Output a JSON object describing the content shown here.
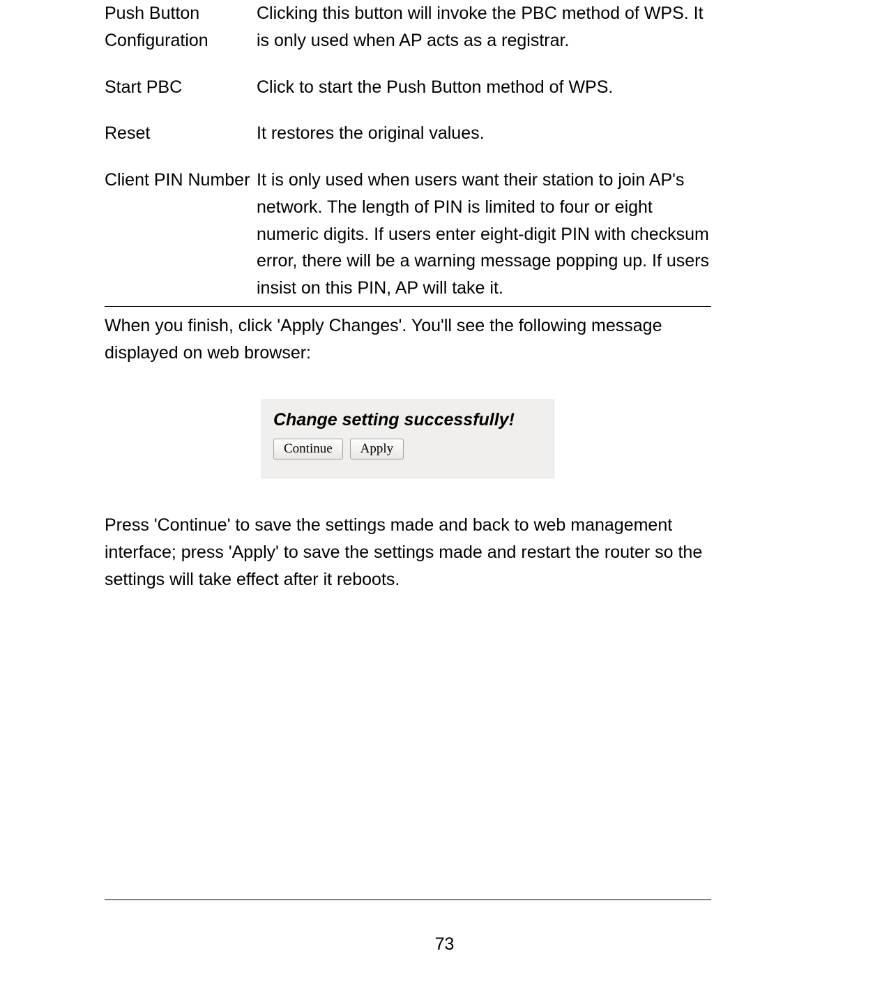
{
  "defs": [
    {
      "term": "Push Button Configuration",
      "desc": "Clicking this button will invoke the PBC method of WPS. It is only used when AP acts as a registrar."
    },
    {
      "term": "Start PBC",
      "desc": "Click to start the Push Button method of WPS."
    },
    {
      "term": "Reset",
      "desc": "It restores the original values."
    },
    {
      "term": "Client PIN Number",
      "desc": "It is only used when users want their station to join AP's network. The length of PIN is limited to four or eight numeric digits. If users enter eight-digit PIN with checksum error, there will be a warning message popping up. If users insist on this PIN, AP will take it."
    }
  ],
  "para_after_table": "When you finish, click 'Apply Changes'. You'll see the following message displayed on web browser:",
  "dialog": {
    "title": "Change setting successfully!",
    "continue_label": "Continue",
    "apply_label": "Apply"
  },
  "para_after_dialog": "Press 'Continue' to save the settings made and back to web management interface; press 'Apply' to save the settings made and restart the router so the settings will take effect after it reboots.",
  "page_number": "73"
}
